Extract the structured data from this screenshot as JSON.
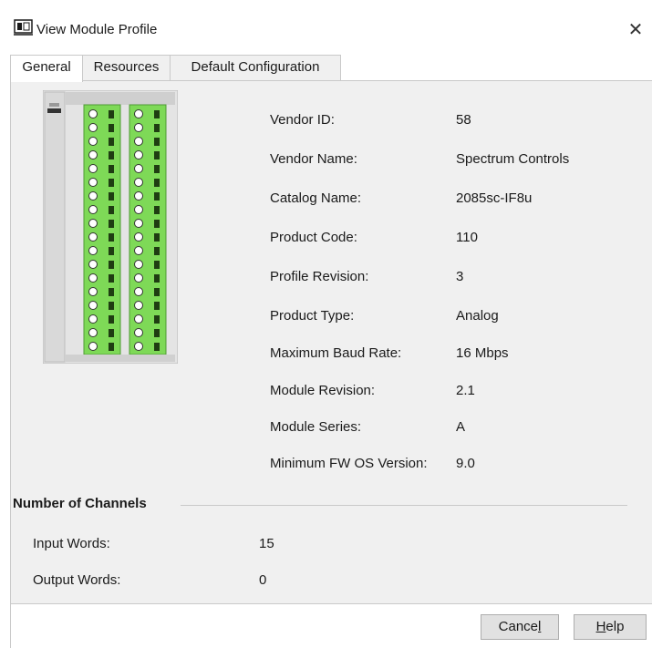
{
  "window": {
    "title": "View Module Profile",
    "close_glyph": "✕"
  },
  "tabs": [
    {
      "label": "General",
      "active": true
    },
    {
      "label": "Resources",
      "active": false
    },
    {
      "label": "Default Configuration",
      "active": false
    }
  ],
  "module_image": {
    "icon": "io-module-terminal-block",
    "accent_color": "#7ed957"
  },
  "properties": [
    {
      "label": "Vendor ID:",
      "value": "58"
    },
    {
      "label": "Vendor Name:",
      "value": "Spectrum Controls"
    },
    {
      "label": "Catalog Name:",
      "value": "2085sc-IF8u"
    },
    {
      "label": "Product Code:",
      "value": "110"
    },
    {
      "label": "Profile Revision:",
      "value": "3"
    },
    {
      "label": "Product Type:",
      "value": "Analog"
    },
    {
      "label": "Maximum Baud Rate:",
      "value": "16 Mbps"
    },
    {
      "label": "Module Revision:",
      "value": "2.1"
    },
    {
      "label": "Module Series:",
      "value": "A"
    },
    {
      "label": "Minimum FW OS Version:",
      "value": "9.0"
    }
  ],
  "channels": {
    "heading": "Number of Channels",
    "rows": [
      {
        "label": "Input Words:",
        "value": "15"
      },
      {
        "label": "Output Words:",
        "value": "0"
      }
    ]
  },
  "buttons": {
    "cancel_pre": "Cance",
    "cancel_mnemonic": "l",
    "help_mnemonic": "H",
    "help_post": "elp"
  }
}
